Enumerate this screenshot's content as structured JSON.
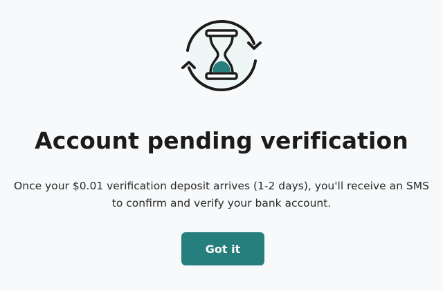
{
  "icon": {
    "name": "hourglass-refresh-icon",
    "accent_color": "#267f7d",
    "circle_fill": "#eef6f6",
    "stroke_color": "#1b1b1b"
  },
  "dialog": {
    "title": "Account pending verification",
    "message": "Once your $0.01 verification deposit arrives (1-2 days), you'll receive an SMS to confirm and verify your bank account.",
    "button_label": "Got it"
  },
  "colors": {
    "background": "#f7f9fb",
    "button": "#267f7d",
    "button_text": "#ffffff"
  }
}
